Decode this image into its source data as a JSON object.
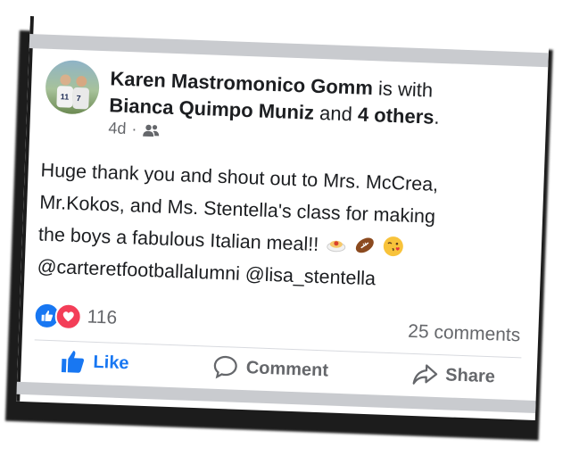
{
  "post": {
    "author": "Karen Mastromonico Gomm",
    "with_text": "is with",
    "tagged_person": "Bianca Quimpo Muniz",
    "and_text": "and",
    "others": "4 others",
    "period": ".",
    "time": "4d",
    "separator": "·",
    "audience_icon": "friends-icon",
    "text_lines": [
      "Huge thank you and shout out to Mrs. McCrea,",
      "Mr.Kokos, and Ms. Stentella's class for making",
      "the boys a fabulous Italian meal!!"
    ],
    "mentions": "@carteretfootballalumni @lisa_stentella",
    "emojis": [
      "spaghetti-icon",
      "football-icon",
      "kiss-face-icon"
    ]
  },
  "engagement": {
    "reaction_count": "116",
    "comments": "25 comments",
    "reaction_icons": [
      "like-reaction-icon",
      "love-reaction-icon"
    ]
  },
  "actions": {
    "like": "Like",
    "comment": "Comment",
    "share": "Share"
  },
  "colors": {
    "facebook_blue": "#1877f2",
    "love_red": "#f33e58",
    "text": "#1c1e21",
    "muted": "#65676b"
  }
}
